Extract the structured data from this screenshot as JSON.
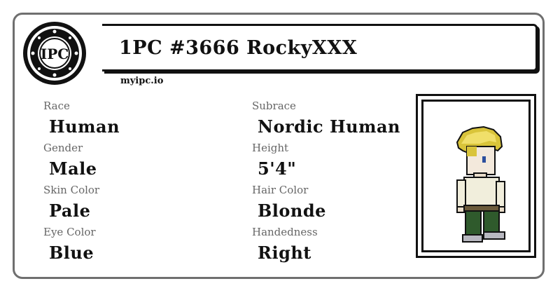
{
  "header": {
    "seal_text": "IPC",
    "title": "1PC #3666 RockyXXX",
    "site": "myipc.io"
  },
  "fields": [
    {
      "label": "Race",
      "value": "Human"
    },
    {
      "label": "Subrace",
      "value": "Nordic Human"
    },
    {
      "label": "Gender",
      "value": "Male"
    },
    {
      "label": "Height",
      "value": "5'4\""
    },
    {
      "label": "Skin Color",
      "value": "Pale"
    },
    {
      "label": "Hair Color",
      "value": "Blonde"
    },
    {
      "label": "Eye Color",
      "value": "Blue"
    },
    {
      "label": "Handedness",
      "value": "Right"
    }
  ],
  "colors": {
    "card_border": "#6f6f6f",
    "label": "#666666",
    "ink": "#111111",
    "hair": "#d9c43a",
    "shirt": "#f1eedc",
    "pants": "#2f5a2c"
  },
  "portrait": {
    "icon": "pixel-character-icon"
  }
}
